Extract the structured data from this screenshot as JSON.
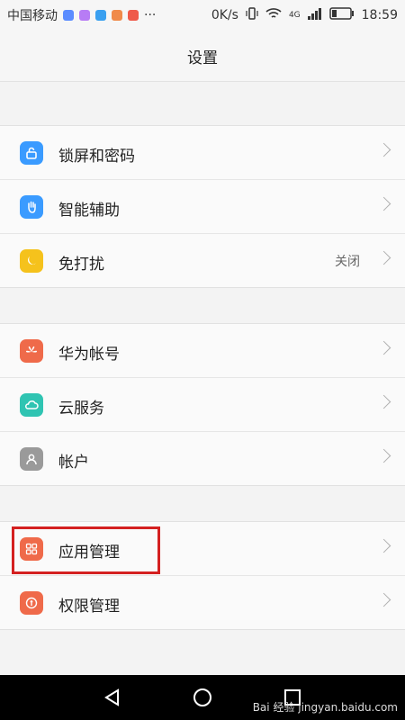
{
  "status_bar": {
    "carrier": "中国移动",
    "dots": "···",
    "speed": "0K/s",
    "network": "4G",
    "time": "18:59"
  },
  "header": {
    "title": "设置"
  },
  "groups": [
    {
      "items": [
        {
          "label": "锁屏和密码",
          "icon": "lock-icon",
          "color": "#3a9bff"
        },
        {
          "label": "智能辅助",
          "icon": "hand-icon",
          "color": "#3a9bff"
        },
        {
          "label": "免打扰",
          "icon": "moon-icon",
          "color": "#f5c21c",
          "value": "关闭"
        }
      ]
    },
    {
      "items": [
        {
          "label": "华为帐号",
          "icon": "huawei-logo-icon",
          "color": "#ef6a4a"
        },
        {
          "label": "云服务",
          "icon": "cloud-icon",
          "color": "#2fc4b2"
        },
        {
          "label": "帐户",
          "icon": "person-icon",
          "color": "#9a9a9a"
        }
      ]
    },
    {
      "items": [
        {
          "label": "应用管理",
          "icon": "apps-grid-icon",
          "color": "#ef6a4a"
        },
        {
          "label": "权限管理",
          "icon": "permission-key-icon",
          "color": "#ef6a4a"
        }
      ]
    }
  ],
  "watermark": {
    "text": "Bai 经验 jingyan.baidu.com"
  }
}
